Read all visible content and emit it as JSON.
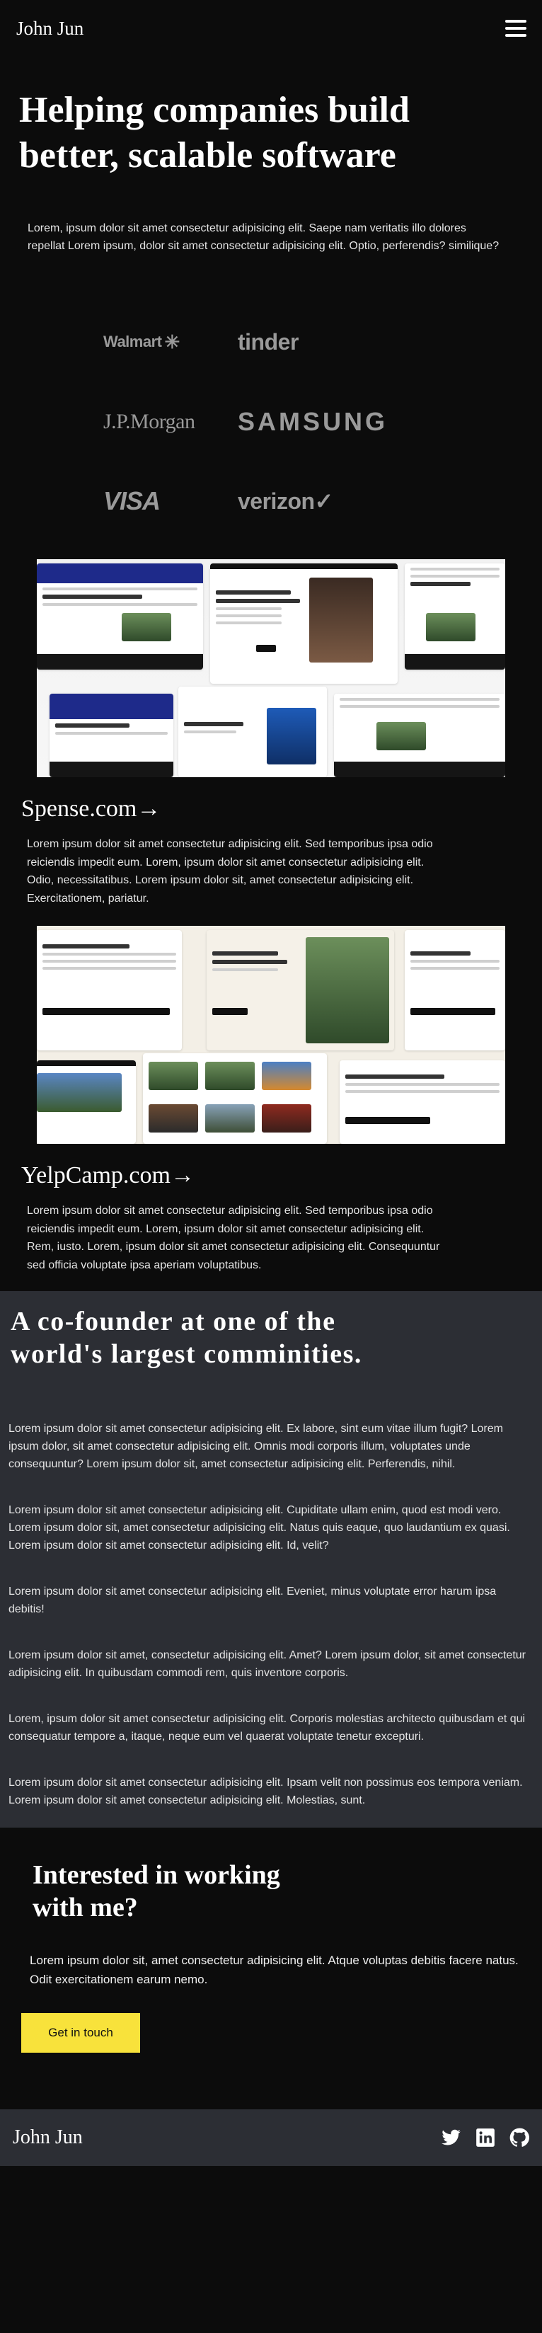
{
  "header": {
    "brand": "John Jun",
    "menu_icon": "hamburger-menu-icon"
  },
  "hero": {
    "title": "Helping companies build better, scalable software",
    "text": "Lorem, ipsum dolor sit amet consectetur adipisicing elit. Saepe nam veritatis illo dolores repellat Lorem ipsum, dolor sit amet consectetur adipisicing elit. Optio, perferendis? similique?"
  },
  "logos": {
    "walmart": "Walmart",
    "tinder": "tinder",
    "jpmorgan": "J.P.Morgan",
    "samsung": "SAMSUNG",
    "visa": "VISA",
    "verizon": "verizon✓"
  },
  "projects": [
    {
      "link": "Spense.com→",
      "description": "Lorem ipsum dolor sit amet consectetur adipisicing elit. Sed temporibus ipsa odio reiciendis impedit eum. Lorem, ipsum dolor sit amet consectetur adipisicing elit. Odio, necessitatibus. Lorem ipsum dolor sit, amet consectetur adipisicing elit. Exercitationem, pariatur."
    },
    {
      "link": "YelpCamp.com→",
      "description": "Lorem ipsum dolor sit amet consectetur adipisicing elit. Sed temporibus ipsa odio reiciendis impedit eum. Lorem, ipsum dolor sit amet consectetur adipisicing elit. Rem, iusto. Lorem, ipsum dolor sit amet consectetur adipisicing elit. Consequuntur sed officia voluptate ipsa aperiam voluptatibus."
    }
  ],
  "community": {
    "title": "A co-founder at one of the world's largest comminities.",
    "paragraphs": [
      "Lorem ipsum dolor sit amet consectetur adipisicing elit. Ex labore, sint eum vitae illum fugit? Lorem ipsum dolor, sit amet consectetur adipisicing elit. Omnis modi corporis illum, voluptates unde consequuntur? Lorem ipsum dolor sit, amet consectetur adipisicing elit. Perferendis, nihil.",
      "Lorem ipsum dolor sit amet consectetur adipisicing elit. Cupiditate ullam enim, quod est modi vero. Lorem ipsum dolor sit, amet consectetur adipisicing elit. Natus quis eaque, quo laudantium ex quasi. Lorem ipsum dolor sit amet consectetur adipisicing elit. Id, velit?",
      "Lorem ipsum dolor sit amet consectetur adipisicing elit. Eveniet, minus voluptate error harum ipsa debitis!",
      "Lorem ipsum dolor sit amet, consectetur adipisicing elit. Amet? Lorem ipsum dolor, sit amet consectetur adipisicing elit. In quibusdam commodi rem, quis inventore corporis.",
      "Lorem, ipsum dolor sit amet consectetur adipisicing elit. Corporis molestias architecto quibusdam et qui consequatur tempore a, itaque, neque eum vel quaerat voluptate tenetur excepturi.",
      "Lorem ipsum dolor sit amet consectetur adipisicing elit. Ipsam velit non possimus eos tempora veniam. Lorem ipsum dolor sit amet consectetur adipisicing elit. Molestias, sunt."
    ]
  },
  "contact": {
    "title": "Interested in working with me?",
    "text": "Lorem ipsum dolor sit, amet consectetur adipisicing elit. Atque voluptas debitis facere natus. Odit exercitationem earum nemo.",
    "cta_label": "Get in touch"
  },
  "footer": {
    "brand": "John Jun",
    "social_icons": [
      "twitter-icon",
      "linkedin-icon",
      "github-icon"
    ]
  },
  "colors": {
    "background": "#0c0c0c",
    "section_gray": "#2c2e34",
    "cta_yellow": "#f8e23b",
    "logo_gray": "#9a9a9a"
  }
}
